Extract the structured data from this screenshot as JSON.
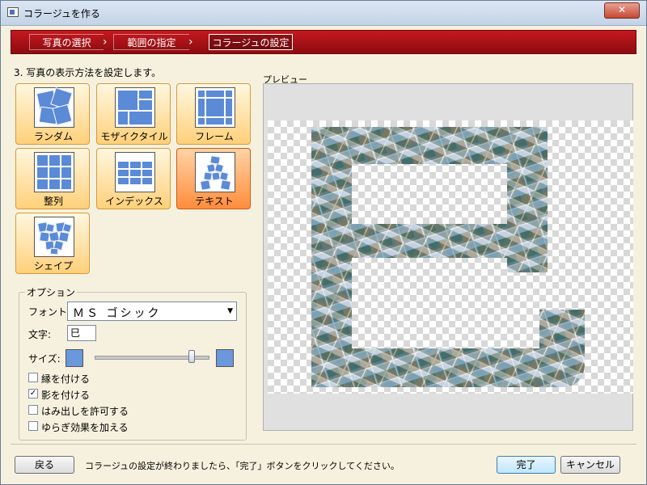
{
  "window": {
    "title": "コラージュを作る",
    "close_label": "✕"
  },
  "steps": [
    {
      "label": "写真の選択"
    },
    {
      "label": "範囲の指定"
    },
    {
      "label": "コラージュの設定"
    }
  ],
  "instruction": "3. 写真の表示方法を設定します。",
  "modes": [
    {
      "label": "ランダム",
      "selected": false
    },
    {
      "label": "モザイクタイル",
      "selected": false
    },
    {
      "label": "フレーム",
      "selected": false
    },
    {
      "label": "整列",
      "selected": false
    },
    {
      "label": "インデックス",
      "selected": false
    },
    {
      "label": "テキスト",
      "selected": true
    },
    {
      "label": "シェイプ",
      "selected": false
    }
  ],
  "options": {
    "title": "オプション",
    "font_label": "フォント:",
    "font_value": "ＭＳ ゴシック",
    "char_label": "文字:",
    "char_value": "巳",
    "size_label": "サイズ:",
    "size_level": 0.85,
    "checkboxes": [
      {
        "label": "縁を付ける",
        "checked": false
      },
      {
        "label": "影を付ける",
        "checked": true
      },
      {
        "label": "はみ出しを許可する",
        "checked": false
      },
      {
        "label": "ゆらぎ効果を加える",
        "checked": false
      }
    ]
  },
  "preview": {
    "label": "プレビュー"
  },
  "footer": {
    "back_label": "戻る",
    "message": "コラージュの設定が終わりましたら、「完了」ボタンをクリックしてください。",
    "finish_label": "完了",
    "cancel_label": "キャンセル"
  },
  "colors": {
    "accent": "#b0141a",
    "tile_blue": "#5b8ad6",
    "selected_orange": "#ff8d3c"
  }
}
